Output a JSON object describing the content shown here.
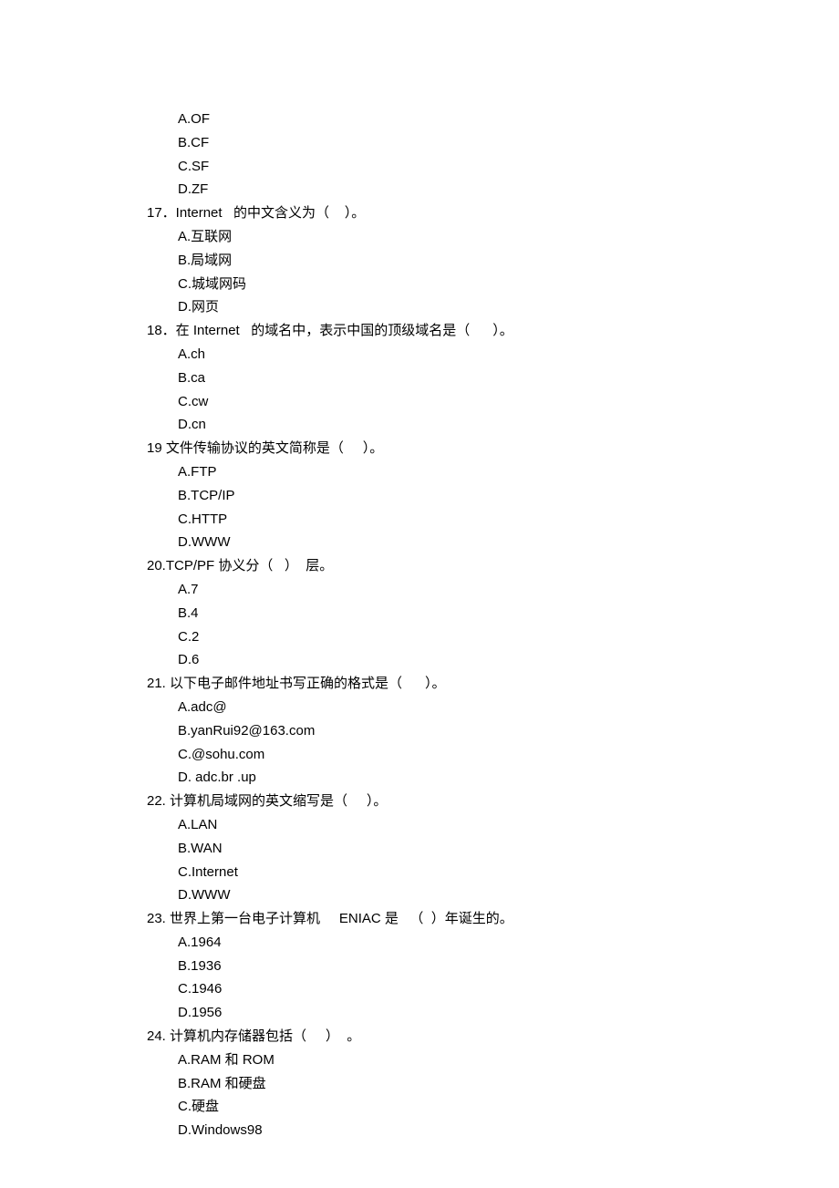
{
  "lines": [
    {
      "type": "option",
      "text": "A.OF"
    },
    {
      "type": "option",
      "text": "B.CF"
    },
    {
      "type": "option",
      "text": "C.SF"
    },
    {
      "type": "option",
      "text": "D.ZF"
    },
    {
      "type": "question",
      "text": "17．Internet   的中文含义为（    ）。"
    },
    {
      "type": "option",
      "text": "A.互联网"
    },
    {
      "type": "option",
      "text": "B.局域网"
    },
    {
      "type": "option",
      "text": "C.城域网码"
    },
    {
      "type": "option",
      "text": "D.网页"
    },
    {
      "type": "question",
      "text": "18．在 Internet   的域名中，表示中国的顶级域名是（      ）。"
    },
    {
      "type": "option",
      "text": "A.ch"
    },
    {
      "type": "option",
      "text": "B.ca"
    },
    {
      "type": "option",
      "text": "C.cw"
    },
    {
      "type": "option",
      "text": "D.cn"
    },
    {
      "type": "question",
      "text": "19 文件传输协议的英文简称是（     ）。"
    },
    {
      "type": "option",
      "text": "A.FTP"
    },
    {
      "type": "option",
      "text": "B.TCP/IP"
    },
    {
      "type": "option",
      "text": "C.HTTP"
    },
    {
      "type": "option",
      "text": "D.WWW"
    },
    {
      "type": "question",
      "text": "20.TCP/PF 协义分（   ）  层。"
    },
    {
      "type": "option",
      "text": "A.7"
    },
    {
      "type": "option",
      "text": "B.4"
    },
    {
      "type": "option",
      "text": "C.2"
    },
    {
      "type": "option",
      "text": "D.6"
    },
    {
      "type": "question",
      "text": "21. 以下电子邮件地址书写正确的格式是（      ）。"
    },
    {
      "type": "option",
      "text": "A.adc@"
    },
    {
      "type": "option",
      "text": "B.yanRui92@163.com"
    },
    {
      "type": "option",
      "text": "C.@sohu.com"
    },
    {
      "type": "option",
      "text": "D. adc.br .up"
    },
    {
      "type": "question",
      "text": "22. 计算机局域网的英文缩写是（     ）。"
    },
    {
      "type": "option",
      "text": "A.LAN"
    },
    {
      "type": "option",
      "text": "B.WAN"
    },
    {
      "type": "option",
      "text": "C.Internet"
    },
    {
      "type": "option",
      "text": "D.WWW"
    },
    {
      "type": "question",
      "text": "23. 世界上第一台电子计算机     ENIAC 是   （  ）年诞生的。"
    },
    {
      "type": "option",
      "text": "A.1964"
    },
    {
      "type": "option",
      "text": "B.1936"
    },
    {
      "type": "option",
      "text": "C.1946"
    },
    {
      "type": "option",
      "text": "D.1956"
    },
    {
      "type": "question",
      "text": "24. 计算机内存储器包括（     ）  。"
    },
    {
      "type": "option",
      "text": "A.RAM 和 ROM"
    },
    {
      "type": "option",
      "text": "B.RAM 和硬盘"
    },
    {
      "type": "option",
      "text": "C.硬盘"
    },
    {
      "type": "option",
      "text": "D.Windows98"
    }
  ]
}
